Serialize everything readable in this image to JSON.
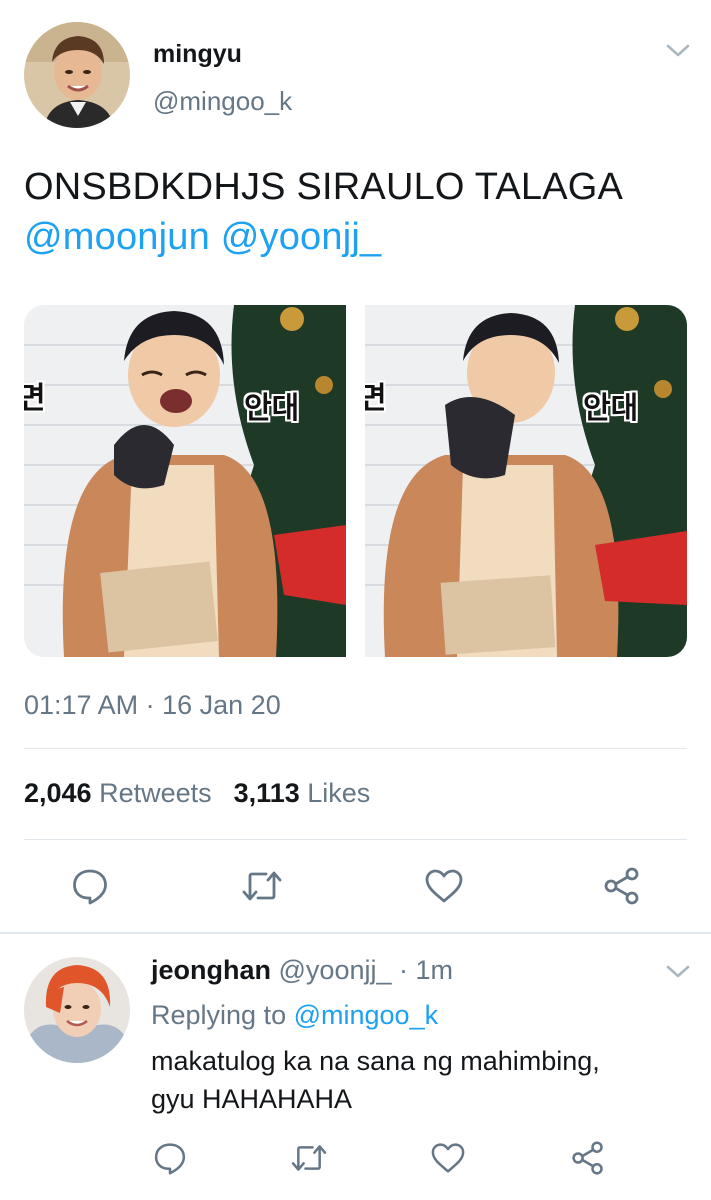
{
  "tweet": {
    "author_name": "mingyu",
    "author_handle": "@mingoo_k",
    "text": "ONSBDKDHJS SIRAULO TALAGA",
    "mention_1": "@moonjun",
    "mention_2": "@yoonjj_",
    "media_captions": {
      "left_edge": "면",
      "left_main": "안대",
      "right_edge": "면",
      "right_main": "안대"
    },
    "time": "01:17 AM",
    "separator": "·",
    "date": "16 Jan 20",
    "retweets_count": "2,046",
    "retweets_label": "Retweets",
    "likes_count": "3,113",
    "likes_label": "Likes"
  },
  "reply": {
    "author_name": "jeonghan",
    "author_handle": "@yoonjj_",
    "separator": "·",
    "age": "1m",
    "replying_prefix": "Replying to",
    "replying_to": "@mingoo_k",
    "text_line_1": "makatulog ka na sana ng mahimbing,",
    "text_line_2": "gyu HAHAHAHA"
  },
  "icons": {
    "reply": "speech-bubble-icon",
    "retweet": "retweet-arrows-icon",
    "like": "heart-icon",
    "share": "share-nodes-icon",
    "more": "chevron-down-icon"
  },
  "colors": {
    "link": "#1da1f2",
    "secondary_text": "#657786",
    "primary_text": "#14171a",
    "divider": "#e1e8ed"
  }
}
